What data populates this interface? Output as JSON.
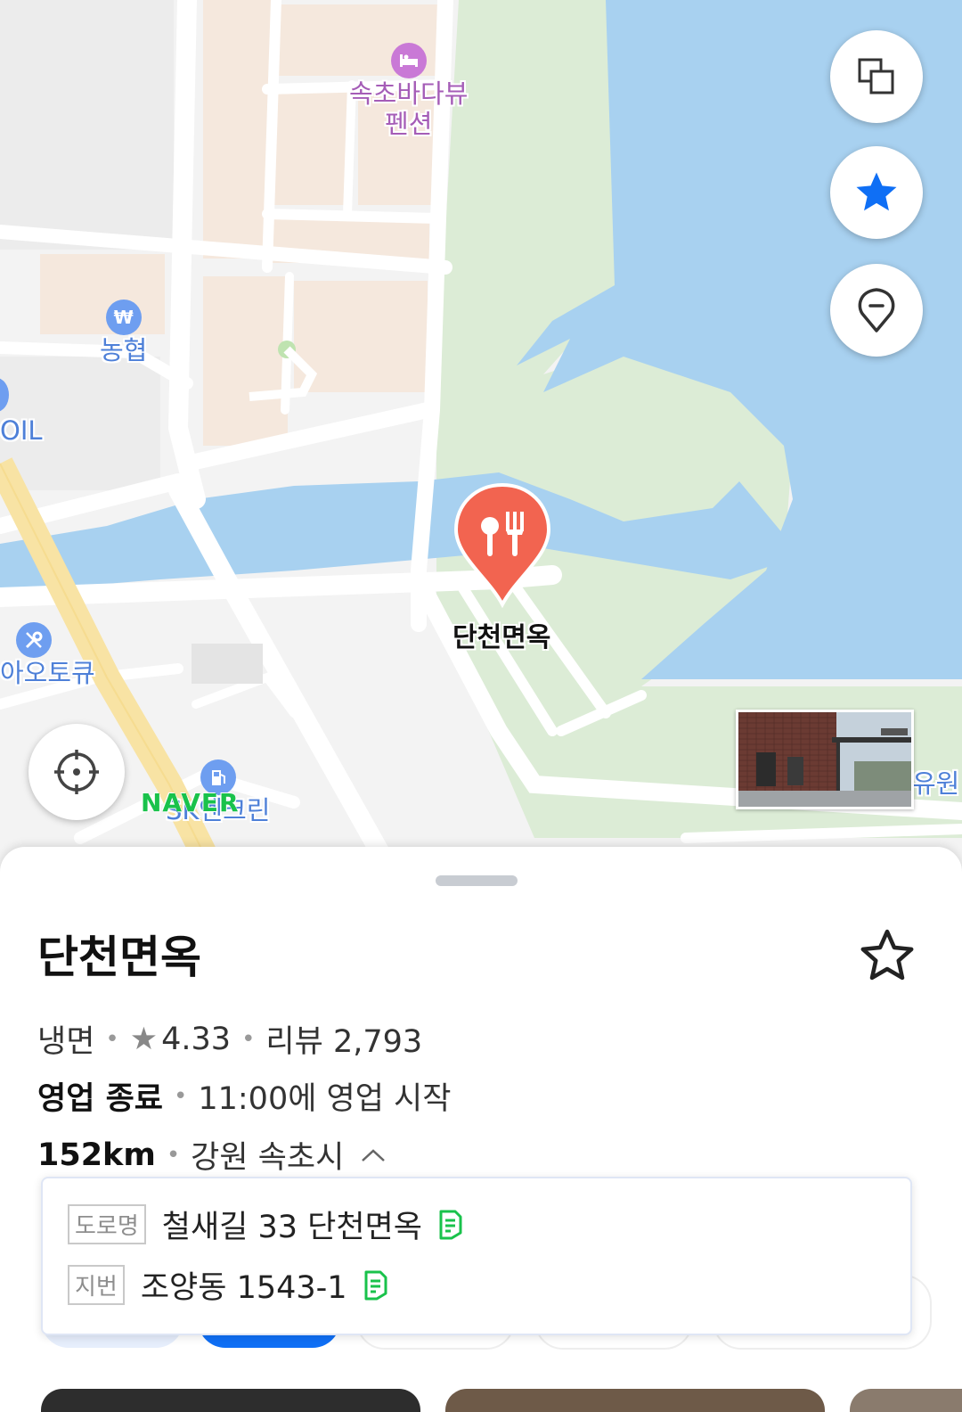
{
  "map": {
    "pois": {
      "pension": "속초바다뷰\n펜션",
      "bank": "농협",
      "oil": "OIL",
      "auto": "아오토큐",
      "gas": "SK엔크린",
      "right_cut": "유원"
    },
    "pin_label": "단천면옥",
    "logo": "NAVER",
    "buttons": {
      "layer": "layer-icon",
      "favorite": "star-icon",
      "marker": "location-pin-icon",
      "locate": "crosshair-icon"
    }
  },
  "place": {
    "name": "단천면옥",
    "category": "냉면",
    "rating": "4.33",
    "review_label": "리뷰 2,793",
    "status": "영업 종료",
    "hours": "11:00에 영업 시작",
    "distance": "152km",
    "region": "강원 속초시"
  },
  "address": {
    "road_tag": "도로명",
    "road": "철새길 33 단천면옥",
    "lot_tag": "지번",
    "lot": "조양동 1543-1"
  },
  "colors": {
    "water": "#a8d1f0",
    "park": "#dcecd6",
    "accent": "#0f6ff5",
    "pin": "#f26450",
    "naver_green": "#19c24b"
  }
}
